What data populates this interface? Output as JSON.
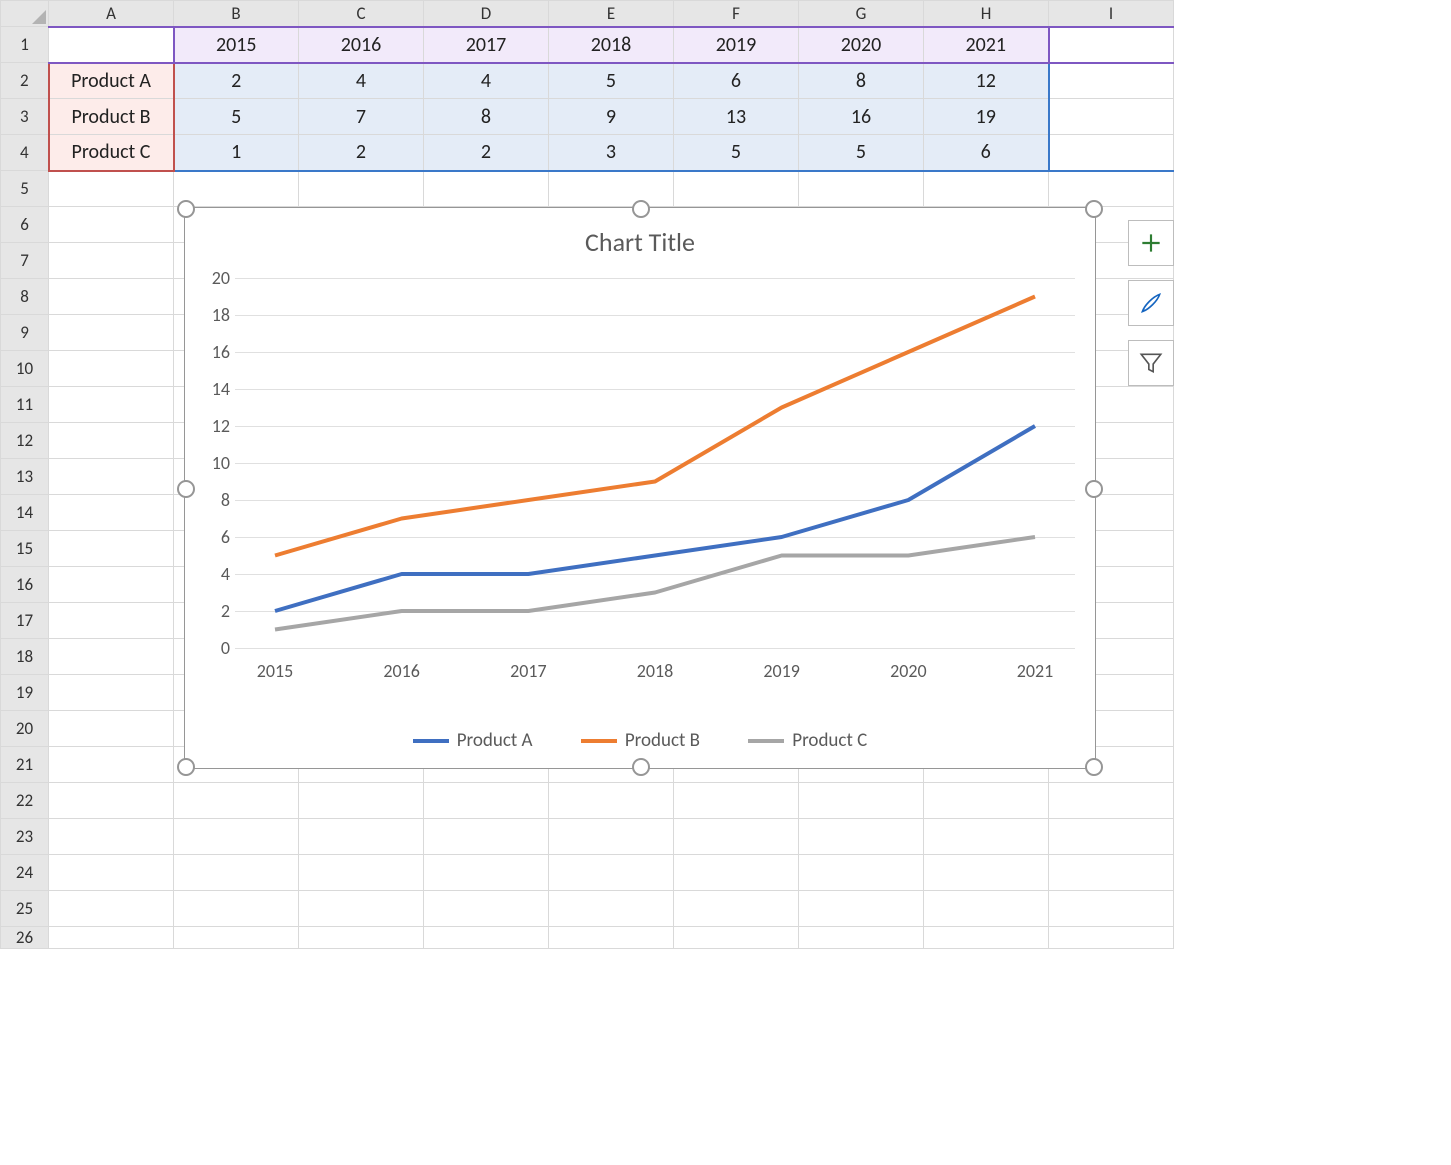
{
  "columns": [
    "A",
    "B",
    "C",
    "D",
    "E",
    "F",
    "G",
    "H",
    "I"
  ],
  "row_numbers": [
    1,
    2,
    3,
    4,
    5,
    6,
    7,
    8,
    9,
    10,
    11,
    12,
    13,
    14,
    15,
    16,
    17,
    18,
    19,
    20,
    21,
    22,
    23,
    24,
    25,
    26
  ],
  "table": {
    "years": [
      "2015",
      "2016",
      "2017",
      "2018",
      "2019",
      "2020",
      "2021"
    ],
    "rows": [
      {
        "label": "Product A",
        "values": [
          "2",
          "4",
          "4",
          "5",
          "6",
          "8",
          "12"
        ]
      },
      {
        "label": "Product B",
        "values": [
          "5",
          "7",
          "8",
          "9",
          "13",
          "16",
          "19"
        ]
      },
      {
        "label": "Product C",
        "values": [
          "1",
          "2",
          "2",
          "3",
          "5",
          "5",
          "6"
        ]
      }
    ]
  },
  "chart": {
    "title": "Chart Title",
    "y_ticks": [
      "0",
      "2",
      "4",
      "6",
      "8",
      "10",
      "12",
      "14",
      "16",
      "18",
      "20"
    ],
    "x_ticks": [
      "2015",
      "2016",
      "2017",
      "2018",
      "2019",
      "2020",
      "2021"
    ],
    "legend": [
      "Product A",
      "Product B",
      "Product C"
    ],
    "colors": {
      "a": "#3f6fc1",
      "b": "#ed7d31",
      "c": "#a6a6a6"
    }
  },
  "chart_data": {
    "type": "line",
    "title": "Chart Title",
    "xlabel": "",
    "ylabel": "",
    "ylim": [
      0,
      20
    ],
    "categories": [
      "2015",
      "2016",
      "2017",
      "2018",
      "2019",
      "2020",
      "2021"
    ],
    "series": [
      {
        "name": "Product A",
        "values": [
          2,
          4,
          4,
          5,
          6,
          8,
          12
        ],
        "color": "#3f6fc1"
      },
      {
        "name": "Product B",
        "values": [
          5,
          7,
          8,
          9,
          13,
          16,
          19
        ],
        "color": "#ed7d31"
      },
      {
        "name": "Product C",
        "values": [
          1,
          2,
          2,
          3,
          5,
          5,
          6
        ],
        "color": "#a6a6a6"
      }
    ],
    "grid": true,
    "legend_position": "bottom"
  },
  "side_buttons": {
    "plus": "chart-elements-button",
    "brush": "chart-styles-button",
    "filter": "chart-filters-button"
  }
}
